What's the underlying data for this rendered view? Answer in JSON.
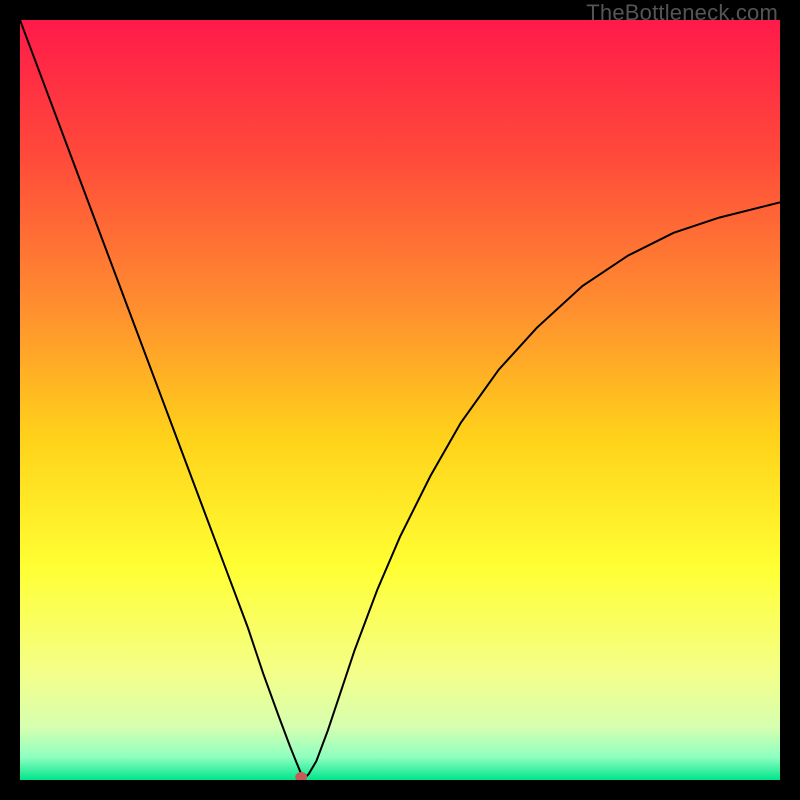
{
  "watermark": "TheBottleneck.com",
  "chart_data": {
    "type": "line",
    "title": "",
    "xlabel": "",
    "ylabel": "",
    "xlim": [
      0,
      100
    ],
    "ylim": [
      0,
      100
    ],
    "grid": false,
    "legend": false,
    "background_gradient": {
      "stops": [
        {
          "offset": 0.0,
          "color": "#ff1a4a"
        },
        {
          "offset": 0.18,
          "color": "#ff4a3a"
        },
        {
          "offset": 0.38,
          "color": "#ff8f2f"
        },
        {
          "offset": 0.55,
          "color": "#ffd21a"
        },
        {
          "offset": 0.72,
          "color": "#ffff33"
        },
        {
          "offset": 0.86,
          "color": "#f4ff8a"
        },
        {
          "offset": 0.93,
          "color": "#d6ffb0"
        },
        {
          "offset": 0.97,
          "color": "#8effc0"
        },
        {
          "offset": 1.0,
          "color": "#00e58a"
        }
      ]
    },
    "series": [
      {
        "name": "curve",
        "color": "#000000",
        "x": [
          0.0,
          3.0,
          6.0,
          9.0,
          12.0,
          15.0,
          18.0,
          21.0,
          24.0,
          27.0,
          30.0,
          32.0,
          34.0,
          35.5,
          36.5,
          37.0,
          37.5,
          38.0,
          39.0,
          40.5,
          42.0,
          44.0,
          47.0,
          50.0,
          54.0,
          58.0,
          63.0,
          68.0,
          74.0,
          80.0,
          86.0,
          92.0,
          98.0,
          100.0
        ],
        "y": [
          100.0,
          92.0,
          84.0,
          76.0,
          68.0,
          60.0,
          52.0,
          44.0,
          36.0,
          28.0,
          20.0,
          14.0,
          8.5,
          4.5,
          2.0,
          0.8,
          0.3,
          0.8,
          2.5,
          6.5,
          11.0,
          17.0,
          25.0,
          32.0,
          40.0,
          47.0,
          54.0,
          59.5,
          65.0,
          69.0,
          72.0,
          74.0,
          75.5,
          76.0
        ]
      }
    ],
    "marker": {
      "x": 37.0,
      "y": 0.0,
      "color": "#c65a55",
      "rx": 6,
      "ry": 5
    }
  }
}
